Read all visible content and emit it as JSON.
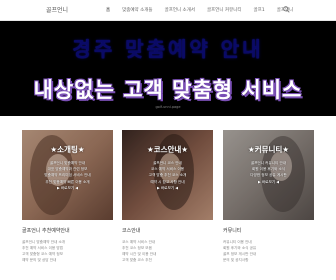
{
  "header": {
    "logo": "골프언니",
    "nav": [
      "홈",
      "맞춤예약 소개들",
      "골프언니 소개서",
      "골프언니 커뮤니티",
      "골프1",
      "골프언니"
    ]
  },
  "hero": {
    "line1": "경주 맞춤예약 안내",
    "line2": "내상없는 고객 맞춤형 서비스",
    "url": "golf-unni.page"
  },
  "cards": [
    {
      "title": "★소개팅★",
      "lines": [
        "골프언니 맞춤예약 안내",
        "대표 맞춤예약과 관련 정보",
        "맞춤예약 프리미엄 서비스 안내",
        "추천 맞춤예약 빠른 이용 소개",
        "▶ 바로보기 ◀"
      ]
    },
    {
      "title": "★코스안내★",
      "lines": [
        "골프언니 코스 안내",
        "코스 예약 서비스 이용",
        "고객 맞춤 추천 코스 소개",
        "예약 시 참고 사항 안내",
        "▶ 바로보기 ◀"
      ]
    },
    {
      "title": "★커뮤니티★",
      "lines": [
        "골프언니 커뮤니티 안내",
        "회원 이용 후기와 소식",
        "다양한 정보 공유 게시판",
        "▶ 바로보기 ◀"
      ]
    }
  ],
  "columns": [
    {
      "title": "골프언니 추천예약안내",
      "lines": [
        "골프언니 맞춤예약 안내 소개",
        "추천 예약 서비스 이용 방법",
        "고객 맞춤형 코스 예약 정보",
        "예약 문의 및 상담 안내"
      ]
    },
    {
      "title": "코스안내",
      "lines": [
        "코스 예약 서비스 안내",
        "추천 코스 정보 모음",
        "예약 시간 및 이용 안내",
        "고객 맞춤 코스 추천"
      ]
    },
    {
      "title": "커뮤니티",
      "lines": [
        "커뮤니티 이용 안내",
        "회원 후기와 소식 공유",
        "골프 정보 게시판 안내",
        "문의 및 공지사항"
      ]
    }
  ]
}
